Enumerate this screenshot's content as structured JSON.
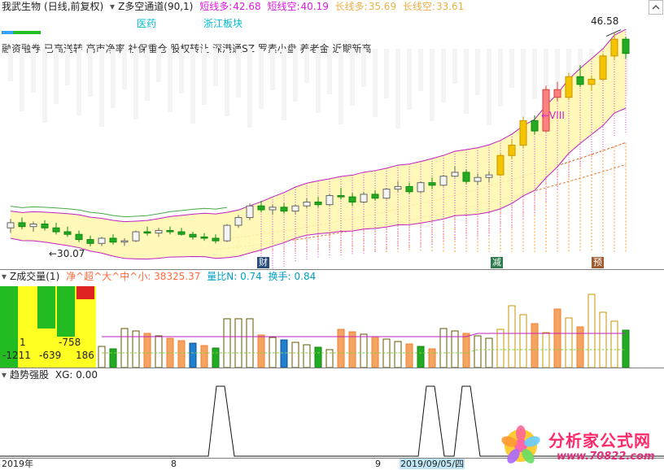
{
  "main": {
    "title": "我武生物",
    "period": "(日线,前复权)",
    "indicator": "Z多空通道(90,1)",
    "short_long_label": "短线多:",
    "short_long_value": "42.68",
    "short_short_label": "短线空:",
    "short_short_value": "40.19",
    "long_long_label": "长线多:",
    "long_long_value": "35.69",
    "long_short_label": "长线空:",
    "long_short_value": "33.61",
    "concept_1": "医药",
    "concept_2": "浙江板块",
    "tags": "融资融券 已高送转 高市净率 社保重仓 股权转让 深港通SZ 罗素小盘 养老金 近期新高",
    "high_label": "46.58",
    "low_label": "←30.07",
    "wave_label": "←VIII",
    "badge_cai": "财",
    "badge_jian": "减",
    "badge_yu": "预",
    "colors": {
      "up": "#ff4040",
      "down": "#22aa22",
      "yellow": "#f5c400",
      "orange": "#f4a460",
      "magenta": "#c020c0"
    }
  },
  "volume": {
    "title": "Z成交量(1)",
    "formula": "净^超^大^中^小: 38325.37",
    "ratio_label": "量比N: 0.74",
    "turnover_label": "换手: 0.84",
    "stat_1": "1",
    "stat_2": "-758",
    "stat_3": "-1211",
    "stat_4": "-639",
    "stat_5": "186"
  },
  "trend": {
    "title": "趋势强股",
    "xg_label": "XG: 0.00"
  },
  "axis": {
    "year": "2019年",
    "month_8": "8",
    "month_9": "9",
    "date_cursor": "2019/09/05/四"
  },
  "watermark": {
    "line1": "分析家公式网",
    "line2": "www.70822.com"
  },
  "chart_data": [
    {
      "type": "candlestick",
      "title": "我武生物",
      "ohlc": [
        [
          31.5,
          32.2,
          31.1,
          31.9
        ],
        [
          31.9,
          32.3,
          31.4,
          31.6
        ],
        [
          31.6,
          32.0,
          31.2,
          31.8
        ],
        [
          31.8,
          32.1,
          31.3,
          31.5
        ],
        [
          31.5,
          31.9,
          31.0,
          31.2
        ],
        [
          31.2,
          31.6,
          30.8,
          31.0
        ],
        [
          31.0,
          31.3,
          30.4,
          30.6
        ],
        [
          30.6,
          30.9,
          30.07,
          30.3
        ],
        [
          30.3,
          30.8,
          30.1,
          30.7
        ],
        [
          30.7,
          31.0,
          30.2,
          30.4
        ],
        [
          30.4,
          30.7,
          30.1,
          30.5
        ],
        [
          30.5,
          31.3,
          30.4,
          31.2
        ],
        [
          31.2,
          31.6,
          30.9,
          31.1
        ],
        [
          31.1,
          31.5,
          30.8,
          31.3
        ],
        [
          31.3,
          31.6,
          31.0,
          31.2
        ],
        [
          31.2,
          31.5,
          30.9,
          31.0
        ],
        [
          31.0,
          31.2,
          30.6,
          30.8
        ],
        [
          30.8,
          31.1,
          30.5,
          30.7
        ],
        [
          30.7,
          31.0,
          30.3,
          30.5
        ],
        [
          30.5,
          31.8,
          30.4,
          31.7
        ],
        [
          31.7,
          32.5,
          31.5,
          32.3
        ],
        [
          32.3,
          33.4,
          32.1,
          33.2
        ],
        [
          33.2,
          33.6,
          32.7,
          32.9
        ],
        [
          32.9,
          33.3,
          32.5,
          33.1
        ],
        [
          33.1,
          33.4,
          32.6,
          32.8
        ],
        [
          32.8,
          33.3,
          32.6,
          33.2
        ],
        [
          33.2,
          33.8,
          33.0,
          33.5
        ],
        [
          33.5,
          33.9,
          33.1,
          33.3
        ],
        [
          33.3,
          34.1,
          33.2,
          34.0
        ],
        [
          34.0,
          34.6,
          33.7,
          33.9
        ],
        [
          33.9,
          34.2,
          33.2,
          33.5
        ],
        [
          33.5,
          34.3,
          33.4,
          34.1
        ],
        [
          34.1,
          34.4,
          33.6,
          33.8
        ],
        [
          33.8,
          34.6,
          33.7,
          34.5
        ],
        [
          34.5,
          35.1,
          34.3,
          34.7
        ],
        [
          34.7,
          35.0,
          34.1,
          34.3
        ],
        [
          34.3,
          35.1,
          34.2,
          35.0
        ],
        [
          35.0,
          35.4,
          34.5,
          34.8
        ],
        [
          34.8,
          35.6,
          34.7,
          35.5
        ],
        [
          35.5,
          36.3,
          35.4,
          35.8
        ],
        [
          35.8,
          36.0,
          34.9,
          35.1
        ],
        [
          35.1,
          35.7,
          34.8,
          35.4
        ],
        [
          35.4,
          35.9,
          35.0,
          35.6
        ],
        [
          35.6,
          37.3,
          35.5,
          37.1
        ],
        [
          37.1,
          38.3,
          36.8,
          37.9
        ],
        [
          37.9,
          40.1,
          37.7,
          39.8
        ],
        [
          39.8,
          40.2,
          38.7,
          39.0
        ],
        [
          39.0,
          42.5,
          38.9,
          42.2
        ],
        [
          42.2,
          42.8,
          41.3,
          41.6
        ],
        [
          41.6,
          43.5,
          41.4,
          43.2
        ],
        [
          43.2,
          44.1,
          42.4,
          42.6
        ],
        [
          42.6,
          43.3,
          42.1,
          43.0
        ],
        [
          43.0,
          45.0,
          42.9,
          44.8
        ],
        [
          44.8,
          46.58,
          44.5,
          46.1
        ],
        [
          46.1,
          46.3,
          44.6,
          45.0
        ]
      ],
      "channel_labels": [
        "短线多",
        "短线空",
        "长线多",
        "长线空"
      ],
      "channel_last_values": [
        42.68,
        40.19,
        35.69,
        33.61
      ]
    },
    {
      "type": "bar",
      "title": "Z成交量(1)",
      "net_value": 38325.37,
      "volume_ratio": 0.74,
      "turnover": 0.84,
      "net_flows": [
        1,
        -758,
        -1211,
        -639,
        186
      ]
    },
    {
      "type": "line",
      "title": "趋势强股",
      "xg_value": 0.0,
      "signals": [
        0,
        1,
        0,
        1,
        1,
        0
      ],
      "xlabels": [
        "2019年",
        "8",
        "9",
        "2019/09/05/四"
      ]
    }
  ]
}
